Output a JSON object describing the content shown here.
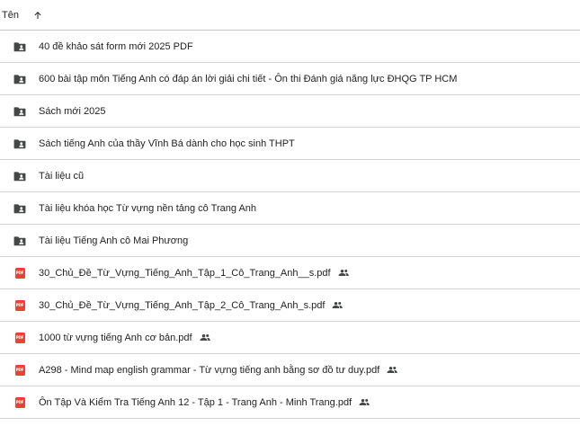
{
  "header": {
    "column_label": "Tên",
    "sort_icon": "arrow-up-icon"
  },
  "items": [
    {
      "type": "shared-folder",
      "icon": "shared-folder-icon",
      "name": "40 đề khảo sát form mới 2025 PDF",
      "shared": false
    },
    {
      "type": "shared-folder",
      "icon": "shared-folder-icon",
      "name": "600 bài tập môn Tiếng Anh có đáp án lời giải chi tiết - Ôn thi Đánh giá năng lực ĐHQG TP HCM",
      "shared": false
    },
    {
      "type": "shared-folder",
      "icon": "shared-folder-icon",
      "name": "Sách mới 2025",
      "shared": false
    },
    {
      "type": "shared-folder",
      "icon": "shared-folder-icon",
      "name": "Sách tiếng Anh của thầy Vĩnh Bá dành cho học sinh THPT",
      "shared": false
    },
    {
      "type": "shared-folder",
      "icon": "shared-folder-icon",
      "name": "Tài liệu cũ",
      "shared": false
    },
    {
      "type": "shared-folder",
      "icon": "shared-folder-icon",
      "name": "Tài liệu khóa học Từ vựng nền tảng cô Trang Anh",
      "shared": false
    },
    {
      "type": "shared-folder",
      "icon": "shared-folder-icon",
      "name": "Tài liệu Tiếng Anh cô Mai Phương",
      "shared": false
    },
    {
      "type": "pdf",
      "icon": "pdf-file-icon",
      "badge": "PDF",
      "name": "30_Chủ_Đề_Từ_Vựng_Tiếng_Anh_Tập_1_Cô_Trang_Anh__s.pdf",
      "shared": true
    },
    {
      "type": "pdf",
      "icon": "pdf-file-icon",
      "badge": "PDF",
      "name": "30_Chủ_Đề_Từ_Vựng_Tiếng_Anh_Tập_2_Cô_Trang_Anh_s.pdf",
      "shared": true
    },
    {
      "type": "pdf",
      "icon": "pdf-file-icon",
      "badge": "PDF",
      "name": "1000 từ vựng tiếng Anh cơ bản.pdf",
      "shared": true
    },
    {
      "type": "pdf",
      "icon": "pdf-file-icon",
      "badge": "PDF",
      "name": "A298 -  Mind map english grammar - Từ vựng tiếng anh bằng sơ đồ tư duy.pdf",
      "shared": true
    },
    {
      "type": "pdf",
      "icon": "pdf-file-icon",
      "badge": "PDF",
      "name": "Ôn Tập Và Kiểm Tra Tiếng Anh 12 - Tập 1 - Trang Anh - Minh Trang.pdf",
      "shared": true
    }
  ],
  "colors": {
    "folder_icon": "#444746",
    "pdf_red": "#ea4335",
    "text": "#1f1f1f",
    "divider": "#d3d3d3"
  }
}
